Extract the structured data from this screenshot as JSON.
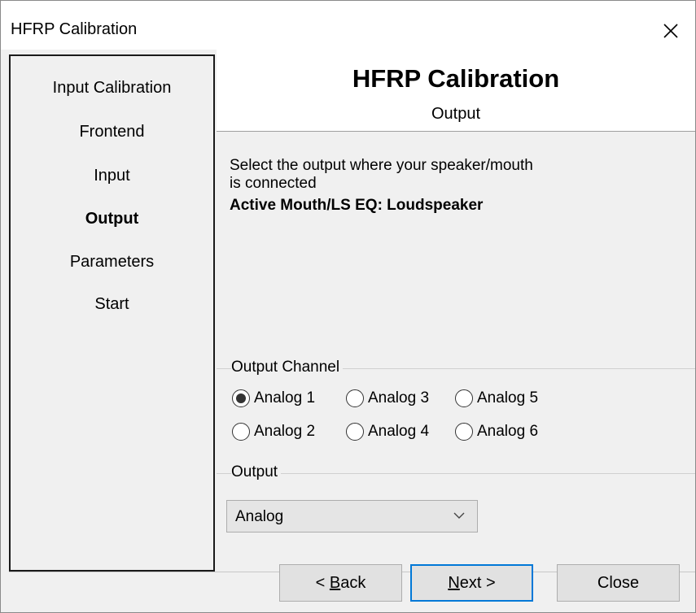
{
  "window": {
    "title": "HFRP Calibration"
  },
  "steps": [
    {
      "label": "Input Calibration",
      "active": false
    },
    {
      "label": "Frontend",
      "active": false
    },
    {
      "label": "Input",
      "active": false
    },
    {
      "label": "Output",
      "active": true
    },
    {
      "label": "Parameters",
      "active": false
    },
    {
      "label": "Start",
      "active": false
    }
  ],
  "header": {
    "title": "HFRP Calibration",
    "subtitle": "Output"
  },
  "description": {
    "line1": "Select the output where your speaker/mouth",
    "line2": "is connected",
    "bold": "Active Mouth/LS EQ: Loudspeaker"
  },
  "output_channel": {
    "legend": "Output Channel",
    "selected": "Analog 1",
    "options": [
      "Analog 1",
      "Analog 3",
      "Analog 5",
      "Analog 2",
      "Analog 4",
      "Analog 6"
    ]
  },
  "output": {
    "legend": "Output",
    "selected": "Analog"
  },
  "buttons": {
    "back_prefix": "< ",
    "back_accel": "B",
    "back_rest": "ack",
    "next_accel": "N",
    "next_rest": "ext >",
    "close": "Close"
  },
  "icons": {
    "close": "close-icon",
    "dropdown": "chevron-down-icon"
  },
  "colors": {
    "accent": "#0078d7"
  }
}
